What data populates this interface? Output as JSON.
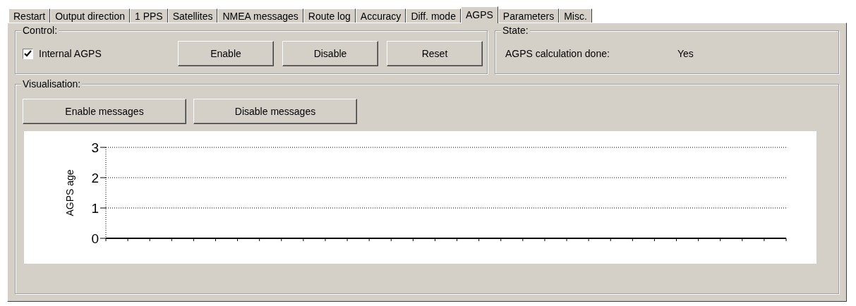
{
  "tabs": [
    {
      "label": "Restart",
      "selected": false
    },
    {
      "label": "Output direction",
      "selected": false
    },
    {
      "label": "1 PPS",
      "selected": false
    },
    {
      "label": "Satellites",
      "selected": false
    },
    {
      "label": "NMEA messages",
      "selected": false
    },
    {
      "label": "Route log",
      "selected": false
    },
    {
      "label": "Accuracy",
      "selected": false
    },
    {
      "label": "Diff. mode",
      "selected": false
    },
    {
      "label": "AGPS",
      "selected": true
    },
    {
      "label": "Parameters",
      "selected": false
    },
    {
      "label": "Misc.",
      "selected": false
    }
  ],
  "control": {
    "title": "Control:",
    "checkbox": {
      "label": "Internal AGPS",
      "checked": true
    },
    "buttons": [
      "Enable",
      "Disable",
      "Reset"
    ]
  },
  "state": {
    "title": "State:",
    "label": "AGPS calculation done:",
    "value": "Yes"
  },
  "visualisation": {
    "title": "Visualisation:",
    "buttons": [
      "Enable messages",
      "Disable messages"
    ],
    "chart": {
      "ylabel": "AGPS age",
      "yticks": [
        "3",
        "2",
        "1",
        "0"
      ]
    }
  }
}
